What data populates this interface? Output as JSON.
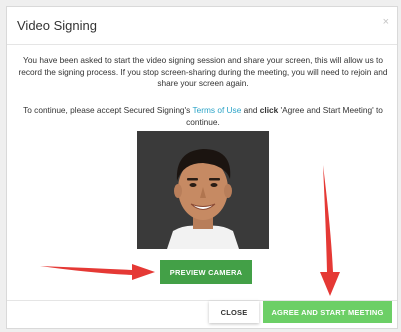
{
  "modal": {
    "title": "Video Signing",
    "close_symbol": "×",
    "paragraph1": "You have been asked to start the video signing session and share your screen, this will allow us to record the signing process. If you stop screen-sharing during the meeting, you will need to rejoin and share your screen again.",
    "paragraph2_before": "To continue, please accept Secured Signing's ",
    "terms_link": "Terms of Use",
    "paragraph2_and": " and ",
    "paragraph2_click": "click",
    "paragraph2_after": " 'Agree and Start Meeting' to continue.",
    "photo_icon": "camera-preview-photo"
  },
  "buttons": {
    "preview_camera": "PREVIEW CAMERA",
    "close": "CLOSE",
    "agree_start": "AGREE AND START MEETING"
  },
  "colors": {
    "accent_green": "#43a047",
    "light_green": "#6ccf66",
    "link_blue": "#2aa3c7",
    "arrow_red": "#e53935"
  }
}
